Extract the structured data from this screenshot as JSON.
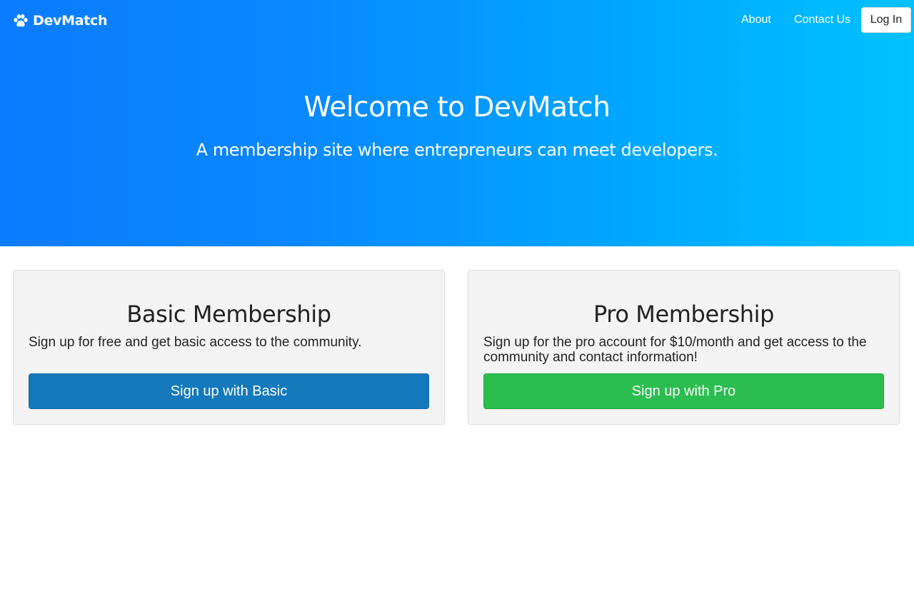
{
  "navbar": {
    "brand": "DevMatch",
    "brand_icon": "paw-icon",
    "links": [
      "About",
      "Contact Us"
    ],
    "login_label": "Log In"
  },
  "hero": {
    "title": "Welcome to DevMatch",
    "subtitle": "A membership site where entrepreneurs can meet developers."
  },
  "plans": {
    "basic": {
      "title": "Basic Membership",
      "description": "Sign up for free and get basic access to the community.",
      "button_label": "Sign up with Basic"
    },
    "pro": {
      "title": "Pro Membership",
      "description": "Sign up for the pro account for $10/month and get access to the community and contact information!",
      "button_label": "Sign up with Pro"
    }
  },
  "colors": {
    "hero_gradient_start": "#0a7cff",
    "hero_gradient_end": "#00c2ff",
    "basic_button": "#1479bb",
    "pro_button": "#2bbd4f",
    "card_background": "#f4f4f4"
  }
}
